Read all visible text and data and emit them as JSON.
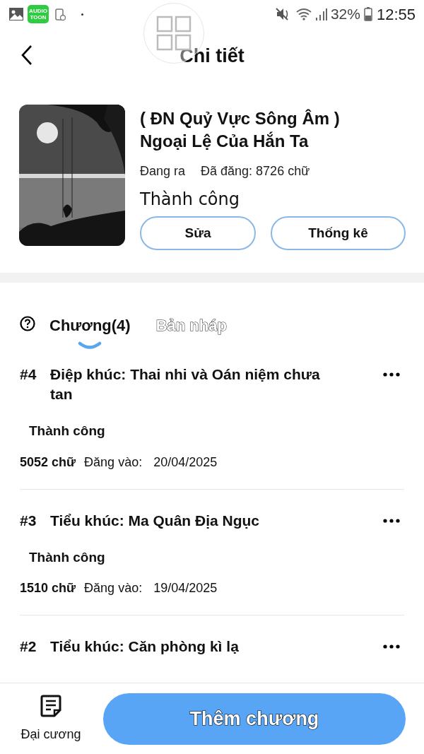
{
  "status_bar": {
    "app_badge": "AUDIO TOON",
    "battery": "32%",
    "time": "12:55"
  },
  "header": {
    "title": "Chi tiết"
  },
  "book": {
    "title": "( ĐN Quỷ Vực Sông Âm ) Ngoại Lệ Của Hắn Ta",
    "state": "Đang ra",
    "posted": "Đã đăng: 8726 chữ",
    "review": "Thành công",
    "buttons": [
      "Sửa",
      "Thống kê"
    ]
  },
  "tabs": [
    {
      "label": "Chương(4)",
      "selected": true
    },
    {
      "label": "Bản nháp",
      "selected": false
    }
  ],
  "chapters": [
    {
      "number": "#4",
      "title": "Điệp khúc: Thai nhi và Oán niệm chưa tan",
      "status": "Thành công",
      "words": "5052 chữ",
      "posted_label": "Đăng vào:",
      "date": "20/04/2025"
    },
    {
      "number": "#3",
      "title": "Tiểu khúc: Ma Quân Địa Ngục",
      "status": "Thành công",
      "words": "1510 chữ",
      "posted_label": "Đăng vào:",
      "date": "19/04/2025"
    },
    {
      "number": "#2",
      "title": "Tiểu khúc: Căn phòng kì lạ"
    }
  ],
  "bottom_bar": {
    "outline_label": "Đại cương",
    "add_button": "Thêm chương"
  }
}
